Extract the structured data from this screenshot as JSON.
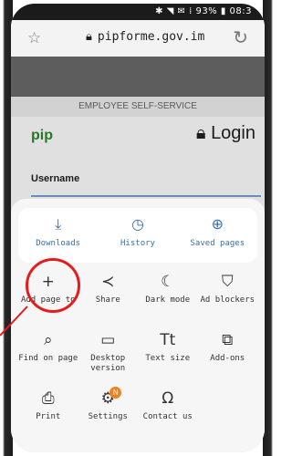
{
  "status": {
    "text": "✱ ◥ ✉ ⁞ 93% ▮ 08:3"
  },
  "addressbar": {
    "url": "pipforme.gov.im"
  },
  "page": {
    "header": "EMPLOYEE SELF-SERVICE",
    "logo": "pip",
    "login": "Login",
    "username_label": "Username"
  },
  "menu": {
    "top": [
      {
        "label": "Downloads",
        "icon": "download-icon"
      },
      {
        "label": "History",
        "icon": "clock-icon"
      },
      {
        "label": "Saved pages",
        "icon": "globe-icon"
      }
    ],
    "rows": [
      [
        {
          "label": "Add page to",
          "icon": "plus-icon"
        },
        {
          "label": "Share",
          "icon": "share-icon"
        },
        {
          "label": "Dark mode",
          "icon": "moon-icon"
        },
        {
          "label": "Ad blockers",
          "icon": "shield-icon"
        }
      ],
      [
        {
          "label": "Find on page",
          "icon": "find-icon"
        },
        {
          "label": "Desktop version",
          "icon": "desktop-icon"
        },
        {
          "label": "Text size",
          "icon": "text-size-icon"
        },
        {
          "label": "Add-ons",
          "icon": "puzzle-icon"
        }
      ],
      [
        {
          "label": "Print",
          "icon": "printer-icon"
        },
        {
          "label": "Settings",
          "icon": "gear-icon",
          "badge": "N"
        },
        {
          "label": "Contact us",
          "icon": "headset-icon"
        }
      ]
    ]
  },
  "annotation": {
    "highlight_color": "#e51c1c"
  }
}
